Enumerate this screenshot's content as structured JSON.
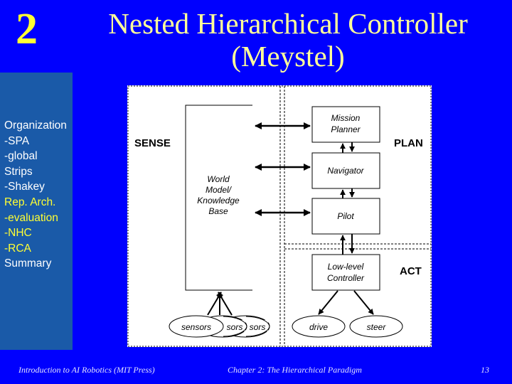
{
  "slide": {
    "chapter_number": "2",
    "title_line1": "Nested Hierarchical Controller",
    "title_line2": "(Meystel)"
  },
  "sidebar": {
    "items": [
      {
        "label": "Organization",
        "current": false
      },
      {
        "label": "-SPA",
        "current": false
      },
      {
        "label": "-global",
        "current": false
      },
      {
        "label": "Strips",
        "current": false
      },
      {
        "label": "-Shakey",
        "current": false
      },
      {
        "label": "Rep. Arch.",
        "current": true
      },
      {
        "label": "-evaluation",
        "current": true
      },
      {
        "label": "-NHC",
        "current": true
      },
      {
        "label": "-RCA",
        "current": true
      },
      {
        "label": "Summary",
        "current": false
      }
    ]
  },
  "diagram": {
    "regions": {
      "sense": "SENSE",
      "plan": "PLAN",
      "act": "ACT"
    },
    "world_model": [
      "World",
      "Model/",
      "Knowledge",
      "Base"
    ],
    "plan_boxes": {
      "mission_planner": [
        "Mission",
        "Planner"
      ],
      "navigator": [
        "Navigator"
      ],
      "pilot": [
        "Pilot"
      ]
    },
    "low_level_controller": [
      "Low-level",
      "Controller"
    ],
    "sensors": [
      "sensors",
      "sors",
      "sors"
    ],
    "actuators": {
      "drive": "drive",
      "steer": "steer"
    }
  },
  "footer": {
    "book": "Introduction to AI Robotics (MIT Press)",
    "chapter": "Chapter 2: The Hierarchical Paradigm",
    "page": "13"
  },
  "colors": {
    "background": "#0000fe",
    "sidebar": "#1a5aa8",
    "title": "#ffff99",
    "highlight": "#ffff33"
  }
}
